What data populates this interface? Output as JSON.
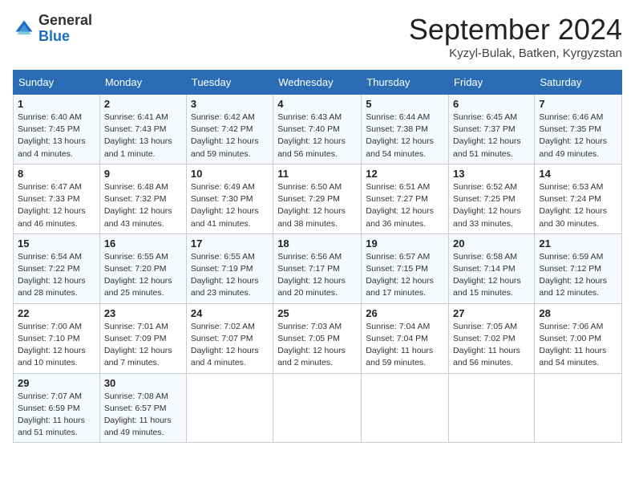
{
  "header": {
    "logo_general": "General",
    "logo_blue": "Blue",
    "month_title": "September 2024",
    "location": "Kyzyl-Bulak, Batken, Kyrgyzstan"
  },
  "columns": [
    "Sunday",
    "Monday",
    "Tuesday",
    "Wednesday",
    "Thursday",
    "Friday",
    "Saturday"
  ],
  "weeks": [
    [
      {
        "day": "1",
        "info": "Sunrise: 6:40 AM\nSunset: 7:45 PM\nDaylight: 13 hours\nand 4 minutes."
      },
      {
        "day": "2",
        "info": "Sunrise: 6:41 AM\nSunset: 7:43 PM\nDaylight: 13 hours\nand 1 minute."
      },
      {
        "day": "3",
        "info": "Sunrise: 6:42 AM\nSunset: 7:42 PM\nDaylight: 12 hours\nand 59 minutes."
      },
      {
        "day": "4",
        "info": "Sunrise: 6:43 AM\nSunset: 7:40 PM\nDaylight: 12 hours\nand 56 minutes."
      },
      {
        "day": "5",
        "info": "Sunrise: 6:44 AM\nSunset: 7:38 PM\nDaylight: 12 hours\nand 54 minutes."
      },
      {
        "day": "6",
        "info": "Sunrise: 6:45 AM\nSunset: 7:37 PM\nDaylight: 12 hours\nand 51 minutes."
      },
      {
        "day": "7",
        "info": "Sunrise: 6:46 AM\nSunset: 7:35 PM\nDaylight: 12 hours\nand 49 minutes."
      }
    ],
    [
      {
        "day": "8",
        "info": "Sunrise: 6:47 AM\nSunset: 7:33 PM\nDaylight: 12 hours\nand 46 minutes."
      },
      {
        "day": "9",
        "info": "Sunrise: 6:48 AM\nSunset: 7:32 PM\nDaylight: 12 hours\nand 43 minutes."
      },
      {
        "day": "10",
        "info": "Sunrise: 6:49 AM\nSunset: 7:30 PM\nDaylight: 12 hours\nand 41 minutes."
      },
      {
        "day": "11",
        "info": "Sunrise: 6:50 AM\nSunset: 7:29 PM\nDaylight: 12 hours\nand 38 minutes."
      },
      {
        "day": "12",
        "info": "Sunrise: 6:51 AM\nSunset: 7:27 PM\nDaylight: 12 hours\nand 36 minutes."
      },
      {
        "day": "13",
        "info": "Sunrise: 6:52 AM\nSunset: 7:25 PM\nDaylight: 12 hours\nand 33 minutes."
      },
      {
        "day": "14",
        "info": "Sunrise: 6:53 AM\nSunset: 7:24 PM\nDaylight: 12 hours\nand 30 minutes."
      }
    ],
    [
      {
        "day": "15",
        "info": "Sunrise: 6:54 AM\nSunset: 7:22 PM\nDaylight: 12 hours\nand 28 minutes."
      },
      {
        "day": "16",
        "info": "Sunrise: 6:55 AM\nSunset: 7:20 PM\nDaylight: 12 hours\nand 25 minutes."
      },
      {
        "day": "17",
        "info": "Sunrise: 6:55 AM\nSunset: 7:19 PM\nDaylight: 12 hours\nand 23 minutes."
      },
      {
        "day": "18",
        "info": "Sunrise: 6:56 AM\nSunset: 7:17 PM\nDaylight: 12 hours\nand 20 minutes."
      },
      {
        "day": "19",
        "info": "Sunrise: 6:57 AM\nSunset: 7:15 PM\nDaylight: 12 hours\nand 17 minutes."
      },
      {
        "day": "20",
        "info": "Sunrise: 6:58 AM\nSunset: 7:14 PM\nDaylight: 12 hours\nand 15 minutes."
      },
      {
        "day": "21",
        "info": "Sunrise: 6:59 AM\nSunset: 7:12 PM\nDaylight: 12 hours\nand 12 minutes."
      }
    ],
    [
      {
        "day": "22",
        "info": "Sunrise: 7:00 AM\nSunset: 7:10 PM\nDaylight: 12 hours\nand 10 minutes."
      },
      {
        "day": "23",
        "info": "Sunrise: 7:01 AM\nSunset: 7:09 PM\nDaylight: 12 hours\nand 7 minutes."
      },
      {
        "day": "24",
        "info": "Sunrise: 7:02 AM\nSunset: 7:07 PM\nDaylight: 12 hours\nand 4 minutes."
      },
      {
        "day": "25",
        "info": "Sunrise: 7:03 AM\nSunset: 7:05 PM\nDaylight: 12 hours\nand 2 minutes."
      },
      {
        "day": "26",
        "info": "Sunrise: 7:04 AM\nSunset: 7:04 PM\nDaylight: 11 hours\nand 59 minutes."
      },
      {
        "day": "27",
        "info": "Sunrise: 7:05 AM\nSunset: 7:02 PM\nDaylight: 11 hours\nand 56 minutes."
      },
      {
        "day": "28",
        "info": "Sunrise: 7:06 AM\nSunset: 7:00 PM\nDaylight: 11 hours\nand 54 minutes."
      }
    ],
    [
      {
        "day": "29",
        "info": "Sunrise: 7:07 AM\nSunset: 6:59 PM\nDaylight: 11 hours\nand 51 minutes."
      },
      {
        "day": "30",
        "info": "Sunrise: 7:08 AM\nSunset: 6:57 PM\nDaylight: 11 hours\nand 49 minutes."
      },
      null,
      null,
      null,
      null,
      null
    ]
  ]
}
